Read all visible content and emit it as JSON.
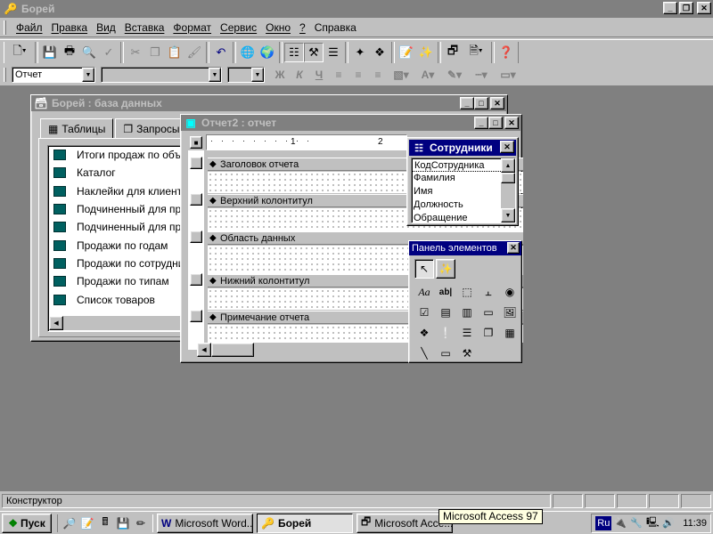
{
  "app": {
    "title": "Борей",
    "icon": "key-icon"
  },
  "menu": [
    "Файл",
    "Правка",
    "Вид",
    "Вставка",
    "Формат",
    "Сервис",
    "Окно",
    "?",
    "Справка"
  ],
  "toolbar2": {
    "object_combo": "Отчет",
    "font_combo": "",
    "size_combo": "",
    "bold": "Ж",
    "italic": "К",
    "underline": "Ч"
  },
  "db_window": {
    "title": "Борей : база данных",
    "tabs": [
      "Таблицы",
      "Запросы"
    ],
    "items": [
      "Итоги продаж по объе",
      "Каталог",
      "Наклейки для клиенто",
      "Подчиненный для про",
      "Подчиненный для про",
      "Продажи по годам",
      "Продажи по сотрудник",
      "Продажи по типам",
      "Список товаров"
    ]
  },
  "report_window": {
    "title": "Отчет2 : отчет",
    "ruler_marks": [
      "1",
      "2"
    ],
    "sections": [
      "Заголовок отчета",
      "Верхний колонтитул",
      "Область данных",
      "Нижний колонтитул",
      "Примечание отчета"
    ]
  },
  "field_list": {
    "title": "Сотрудники",
    "fields": [
      "КодСотрудника",
      "Фамилия",
      "Имя",
      "Должность",
      "Обращение"
    ]
  },
  "toolbox": {
    "title": "Панель элементов",
    "label_tool": "Aa",
    "textbox_tool": "ab|"
  },
  "status": {
    "text": "Конструктор"
  },
  "taskbar": {
    "start": "Пуск",
    "tasks": [
      "Microsoft Word...",
      "Борей",
      "Microsoft Acce..."
    ],
    "active_task": "Борей",
    "tooltip": "Microsoft Access 97",
    "lang": "Ru",
    "clock": "11:39"
  }
}
